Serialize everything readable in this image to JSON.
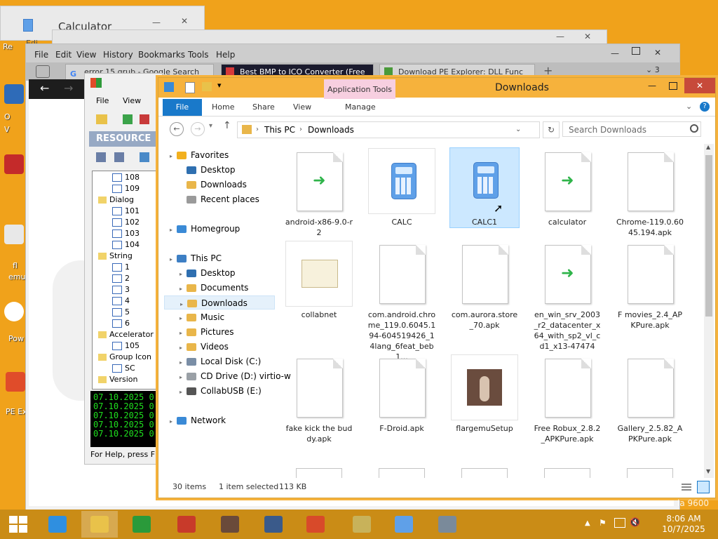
{
  "desktop_hints": [
    "Re",
    "O",
    "V",
    "fl",
    "emu",
    "Pow",
    "PE Ex"
  ],
  "calculator_window": {
    "title": "Calculator",
    "edit": "Edi"
  },
  "firefox": {
    "menu": [
      "File",
      "Edit",
      "View",
      "History",
      "Bookmarks",
      "Tools",
      "Help"
    ],
    "tabs": [
      "error 15 grub - Google Search",
      "Best BMP to ICO Converter (Free",
      "Download PE Explorer: DLL Func"
    ],
    "tab_count": "3"
  },
  "pe_explorer": {
    "menu": [
      "File",
      "View"
    ],
    "resource_header": "RESOURCE",
    "tree": [
      {
        "label": "108",
        "level": 2
      },
      {
        "label": "109",
        "level": 2
      },
      {
        "label": "Dialog",
        "level": 1
      },
      {
        "label": "101",
        "level": 2
      },
      {
        "label": "102",
        "level": 2
      },
      {
        "label": "103",
        "level": 2
      },
      {
        "label": "104",
        "level": 2
      },
      {
        "label": "String",
        "level": 1
      },
      {
        "label": "1",
        "level": 2
      },
      {
        "label": "2",
        "level": 2
      },
      {
        "label": "3",
        "level": 2
      },
      {
        "label": "4",
        "level": 2
      },
      {
        "label": "5",
        "level": 2
      },
      {
        "label": "6",
        "level": 2
      },
      {
        "label": "Accelerator",
        "level": 1
      },
      {
        "label": "105",
        "level": 2
      },
      {
        "label": "Group Icon",
        "level": 1
      },
      {
        "label": "SC",
        "level": 2
      },
      {
        "label": "Version",
        "level": 1
      }
    ],
    "log": [
      "07.10.2025 0",
      "07.10.2025 0",
      "07.10.2025 0",
      "07.10.2025 0",
      "07.10.2025 0"
    ],
    "status": "For Help, press F1"
  },
  "explorer": {
    "title": "Downloads",
    "app_tools": "Application Tools",
    "ribbon": {
      "file": "File",
      "tabs": [
        "Home",
        "Share",
        "View"
      ],
      "manage": "Manage"
    },
    "address": [
      "This PC",
      "Downloads"
    ],
    "search_placeholder": "Search Downloads",
    "nav": [
      {
        "label": "Favorites",
        "icon": "star-icon",
        "level": 0,
        "color": "#f2b01e"
      },
      {
        "label": "Desktop",
        "icon": "desktop-icon",
        "level": 1,
        "color": "#2f6fb0"
      },
      {
        "label": "Downloads",
        "icon": "downloads-folder-icon",
        "level": 1,
        "color": "#e9b64a"
      },
      {
        "label": "Recent places",
        "icon": "recent-places-icon",
        "level": 1,
        "color": "#9a9a9a"
      },
      {
        "label": "Homegroup",
        "icon": "homegroup-icon",
        "level": 0,
        "color": "#3a8ad6"
      },
      {
        "label": "This PC",
        "icon": "computer-icon",
        "level": 0,
        "color": "#3d7fc4"
      },
      {
        "label": "Desktop",
        "icon": "desktop-icon",
        "level": 1,
        "color": "#2f6fb0"
      },
      {
        "label": "Documents",
        "icon": "documents-icon",
        "level": 1,
        "color": "#e9b64a"
      },
      {
        "label": "Downloads",
        "icon": "downloads-folder-icon",
        "level": 1,
        "color": "#e9b64a",
        "selected": true
      },
      {
        "label": "Music",
        "icon": "music-icon",
        "level": 1,
        "color": "#e9b64a"
      },
      {
        "label": "Pictures",
        "icon": "pictures-icon",
        "level": 1,
        "color": "#e9b64a"
      },
      {
        "label": "Videos",
        "icon": "videos-icon",
        "level": 1,
        "color": "#e9b64a"
      },
      {
        "label": "Local Disk (C:)",
        "icon": "disk-icon",
        "level": 1,
        "color": "#7a8ea6"
      },
      {
        "label": "CD Drive (D:) virtio-w",
        "icon": "cd-drive-icon",
        "level": 1,
        "color": "#9aa0a6"
      },
      {
        "label": "CollabUSB (E:)",
        "icon": "usb-drive-icon",
        "level": 1,
        "color": "#555555"
      },
      {
        "label": "Network",
        "icon": "network-icon",
        "level": 0,
        "color": "#3a8ad6"
      }
    ],
    "files": [
      {
        "name": "android-x86-9.0-r2",
        "type": "arrow"
      },
      {
        "name": "CALC",
        "type": "calc"
      },
      {
        "name": "CALC1",
        "type": "calc",
        "selected": true
      },
      {
        "name": "calculator",
        "type": "arrow"
      },
      {
        "name": "Chrome-119.0.6045.194.apk",
        "type": "doc"
      },
      {
        "name": "collabnet",
        "type": "cert"
      },
      {
        "name": "com.android.chrome_119.0.6045.194-604519426_14lang_6feat_beb1...",
        "type": "doc"
      },
      {
        "name": "com.aurora.store_70.apk",
        "type": "doc"
      },
      {
        "name": "en_win_srv_2003_r2_datacenter_x64_with_sp2_vl_cd1_x13-47474",
        "type": "arrow"
      },
      {
        "name": "F movies_2.4_APKPure.apk",
        "type": "doc"
      },
      {
        "name": "fake kick the buddy.apk",
        "type": "doc"
      },
      {
        "name": "F-Droid.apk",
        "type": "doc"
      },
      {
        "name": "flargemuSetup",
        "type": "photo"
      },
      {
        "name": "Free Robux_2.8.2_APKPure.apk",
        "type": "doc"
      },
      {
        "name": "Gallery_2.5.82_APKPure.apk",
        "type": "doc"
      }
    ],
    "status": {
      "count": "30 items",
      "selected": "1 item selected",
      "size": "113 KB"
    }
  },
  "taskbar": {
    "apps": [
      "start-icon",
      "ie-icon",
      "file-explorer-icon",
      "store-icon",
      "app-red-icon",
      "app-photo-icon",
      "virtualbox-icon",
      "pe-explorer-icon",
      "cd-icon",
      "calculator-icon",
      "device-manager-icon"
    ],
    "time": "8:06 AM",
    "date": "10/7/2025",
    "watermark": "la 9600"
  }
}
